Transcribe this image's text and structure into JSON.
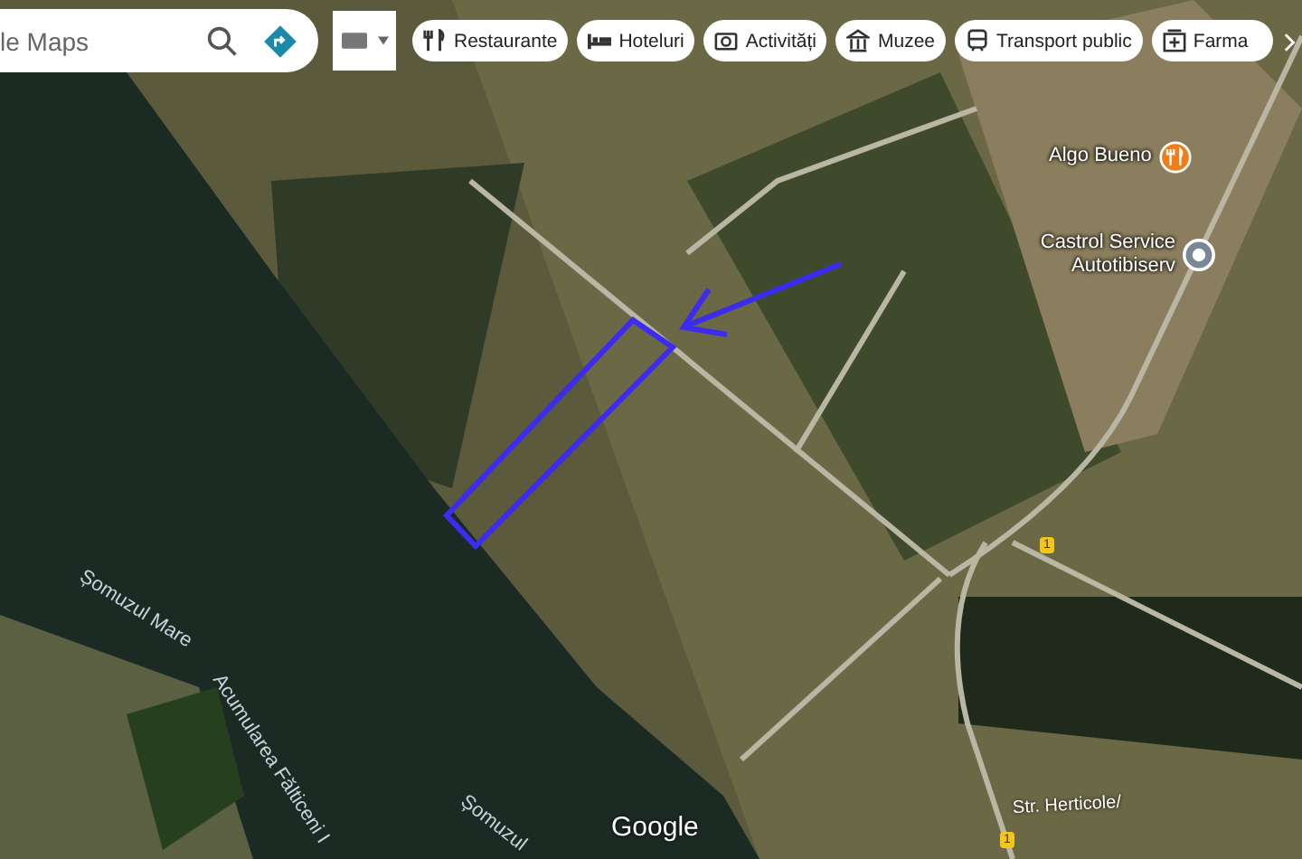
{
  "search": {
    "placeholder": "le Maps"
  },
  "chips": [
    {
      "label": "Restaurante",
      "kind": "restaurant"
    },
    {
      "label": "Hoteluri",
      "kind": "hotel"
    },
    {
      "label": "Activități",
      "kind": "camera"
    },
    {
      "label": "Muzee",
      "kind": "museum"
    },
    {
      "label": "Transport public",
      "kind": "transit"
    },
    {
      "label": "Farma",
      "kind": "pharmacy"
    }
  ],
  "places": [
    {
      "name": "Algo Bueno",
      "kind": "restaurant"
    },
    {
      "name": "Castrol Service Autotibiserv",
      "kind": "service"
    }
  ],
  "water_labels": [
    "Șomuzul Mare",
    "Acumularea Fălticeni I",
    "Șomuzul"
  ],
  "road_label": "Str. Herticole/",
  "route_shields": [
    "1",
    "1"
  ],
  "logo": "Google"
}
